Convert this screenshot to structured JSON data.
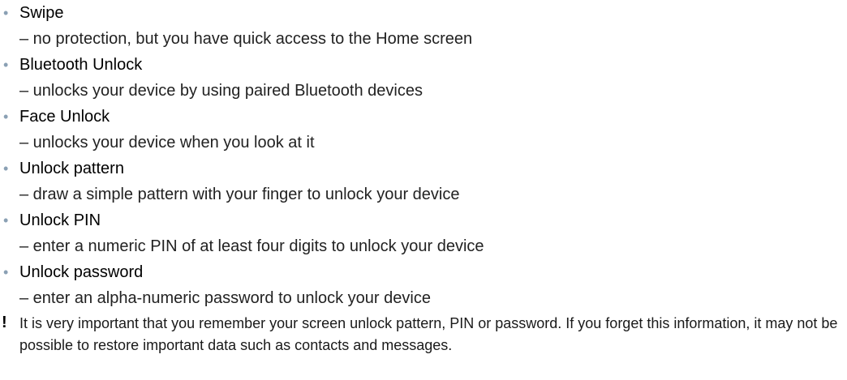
{
  "list": {
    "bullet_glyph": "•",
    "items": [
      {
        "term": "Swipe",
        "description": "– no protection, but you have quick access to the Home screen"
      },
      {
        "term": "Bluetooth Unlock",
        "description": "– unlocks your device by using paired Bluetooth devices"
      },
      {
        "term": "Face Unlock",
        "description": "– unlocks your device when you look at it"
      },
      {
        "term": "Unlock pattern",
        "description": "– draw a simple pattern with your finger to unlock your device"
      },
      {
        "term": "Unlock PIN",
        "description": "– enter a numeric PIN of at least four digits to unlock your device"
      },
      {
        "term": "Unlock password",
        "description": "– enter an alpha-numeric password to unlock your device"
      }
    ]
  },
  "note": {
    "icon": "exclamation-icon",
    "text": "It is very important that you remember your screen unlock pattern, PIN or password. If you forget this information, it may not be possible to restore important data such as contacts and messages."
  }
}
